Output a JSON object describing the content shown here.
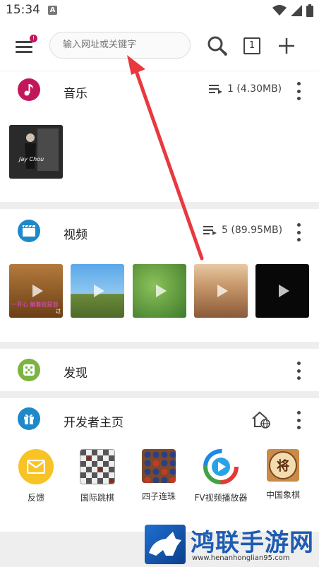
{
  "status": {
    "time": "15:34",
    "a_badge": "A"
  },
  "toolbar": {
    "search_placeholder": "输入网址或关键字",
    "tab_count": "1",
    "menu_badge": "!"
  },
  "music": {
    "title": "音乐",
    "count": "1 (4.30MB)",
    "album_caption": "Jay Chou"
  },
  "video": {
    "title": "视频",
    "count": "5 (89.95MB)",
    "thumb1_caption": "一开心 躺着就是浪",
    "thumb1_tag": "过"
  },
  "discover": {
    "title": "发现"
  },
  "dev": {
    "title": "开发者主页",
    "apps": [
      {
        "label": "反馈"
      },
      {
        "label": "国际跳棋"
      },
      {
        "label": "四子连珠"
      },
      {
        "label": "FV视频播放器"
      },
      {
        "label": "中国象棋",
        "glyph": "将"
      }
    ]
  },
  "watermark": {
    "brand": "鸿联手游网",
    "url": "www.henanhonglian95.com"
  },
  "colors": {
    "music_accent": "#c2185b",
    "video_accent": "#1e88c9",
    "discover_accent": "#7cb342",
    "dev_accent": "#1e88c9",
    "arrow": "#e8393f"
  }
}
